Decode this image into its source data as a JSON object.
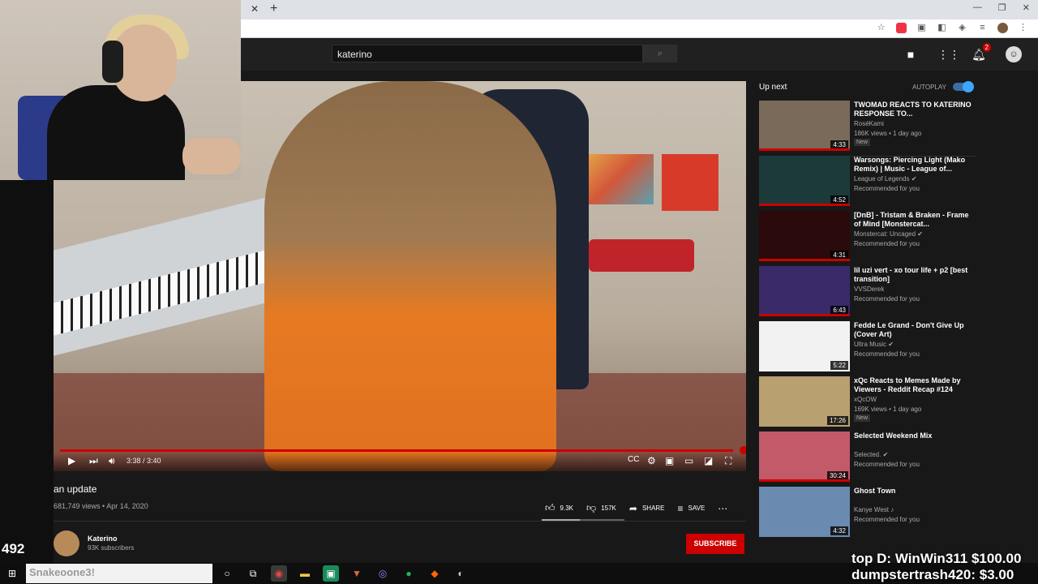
{
  "search": {
    "query": "katerino"
  },
  "header": {
    "notification_count": "2"
  },
  "player": {
    "time": "3:38 / 3:40",
    "progress": 0.99
  },
  "video": {
    "title": "an update",
    "views_date": "681,749 views • Apr 14, 2020",
    "likes": "9.3K",
    "dislikes": "157K",
    "share_label": "SHARE",
    "save_label": "SAVE"
  },
  "channel": {
    "name": "Katerino",
    "subscribers": "93K subscribers",
    "subscribe_label": "SUBSCRIBE"
  },
  "sidebar": {
    "up_next_label": "Up next",
    "autoplay_label": "AUTOPLAY",
    "items": [
      {
        "title": "TWOMAD REACTS TO KATERINO RESPONSE TO...",
        "channel": "RoséKami",
        "meta": "186K views • 1 day ago",
        "badge": "New",
        "duration": "4:33",
        "thumb_color": "#7a6a5a",
        "watched": 1.0
      },
      {
        "title": "Warsongs: Piercing Light (Mako Remix) | Music - League of...",
        "channel": "League of Legends ✔",
        "meta": "Recommended for you",
        "badge": "",
        "duration": "4:52",
        "thumb_color": "#1d3a3a",
        "watched": 1.0
      },
      {
        "title": "[DnB] - Tristam & Braken - Frame of Mind [Monstercat...",
        "channel": "Monstercat: Uncaged ✔",
        "meta": "Recommended for you",
        "badge": "",
        "duration": "4:31",
        "thumb_color": "#2a0a0a",
        "watched": 1.0
      },
      {
        "title": "lil uzi vert - xo tour life + p2 [best transition]",
        "channel": "VVSDerek",
        "meta": "Recommended for you",
        "badge": "",
        "duration": "6:43",
        "thumb_color": "#3a2a6a",
        "watched": 1.0
      },
      {
        "title": "Fedde Le Grand - Don't Give Up (Cover Art)",
        "channel": "Ultra Music ✔",
        "meta": "Recommended for you",
        "badge": "",
        "duration": "5:22",
        "thumb_color": "#f2f2f2",
        "watched": 0
      },
      {
        "title": "xQc Reacts to Memes Made by Viewers - Reddit Recap #124",
        "channel": "xQcOW",
        "meta": "169K views • 1 day ago",
        "badge": "New",
        "duration": "17:26",
        "thumb_color": "#b8a070",
        "watched": 0
      },
      {
        "title": "Selected Weekend Mix",
        "channel": "Selected. ✔",
        "meta": "Recommended for you",
        "badge": "",
        "duration": "30:24",
        "thumb_color": "#c25a6a",
        "watched": 1.0
      },
      {
        "title": "Ghost Town",
        "channel": "Kanye West ♪",
        "meta": "Recommended for you",
        "badge": "",
        "duration": "4:32",
        "thumb_color": "#6a8ab0",
        "watched": 0
      }
    ]
  },
  "taskbar": {
    "search_text": "Snakeoone3!"
  },
  "overlay": {
    "viewer_count": "492",
    "donation_line1": "top D: WinWin311 $100.00",
    "donation_line2": "dumpstertrash420: $3.00"
  }
}
